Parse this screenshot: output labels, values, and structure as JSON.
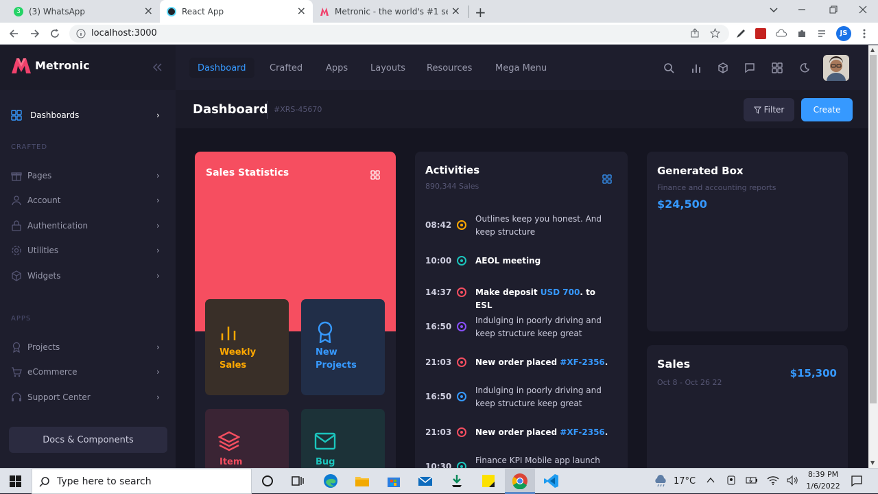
{
  "browser": {
    "tabs": [
      {
        "label": "(3) WhatsApp",
        "badge": "3"
      },
      {
        "label": "React App"
      },
      {
        "label": "Metronic - the world's #1 selling"
      }
    ],
    "url": "localhost:3000",
    "profile_initials": "JS"
  },
  "app": {
    "brand": "Metronic",
    "sidebar": {
      "top_item": "Dashboards",
      "section_crafted": "CRAFTED",
      "crafted_items": [
        "Pages",
        "Account",
        "Authentication",
        "Utilities",
        "Widgets"
      ],
      "section_apps": "APPS",
      "apps_items": [
        "Projects",
        "eCommerce",
        "Support Center"
      ],
      "docs_button": "Docs & Components"
    },
    "header_nav": [
      "Dashboard",
      "Crafted",
      "Apps",
      "Layouts",
      "Resources",
      "Mega Menu"
    ],
    "toolbar": {
      "title": "Dashboard",
      "code": "#XRS-45670",
      "filter_label": "Filter",
      "create_label": "Create"
    },
    "sales_statistics": {
      "title": "Sales Statistics",
      "tiles": [
        {
          "line1": "Weekly",
          "line2": "Sales"
        },
        {
          "line1": "New",
          "line2": "Projects"
        },
        {
          "line1": "Item",
          "line2": ""
        },
        {
          "line1": "Bug",
          "line2": ""
        }
      ]
    },
    "activities": {
      "title": "Activities",
      "subtitle": "890,344 Sales",
      "items": [
        {
          "time": "08:42",
          "text": "Outlines keep you honest. And keep structure",
          "bold": false,
          "color": "#ffa800"
        },
        {
          "time": "10:00",
          "text": "AEOL meeting",
          "bold": true,
          "color": "#1bc5bd"
        },
        {
          "time": "14:37",
          "text_pre": "Make deposit ",
          "link": "USD 700",
          "text_post": ". to ESL",
          "bold": true,
          "color": "#f64e60"
        },
        {
          "time": "16:50",
          "text": "Indulging in poorly driving and keep structure keep great",
          "bold": false,
          "color": "#8950fc"
        },
        {
          "time": "21:03",
          "text_pre": "New order placed ",
          "link": "#XF-2356",
          "text_post": ".",
          "bold": true,
          "color": "#f64e60"
        },
        {
          "time": "16:50",
          "text": "Indulging in poorly driving and keep structure keep great",
          "bold": false,
          "color": "#3699ff"
        },
        {
          "time": "21:03",
          "text_pre": "New order placed ",
          "link": "#XF-2356",
          "text_post": ".",
          "bold": true,
          "color": "#f64e60"
        },
        {
          "time": "10:30",
          "text": "Finance KPI Mobile app launch",
          "bold": false,
          "color": "#1bc5bd"
        }
      ]
    },
    "generated_box": {
      "title": "Generated Box",
      "subtitle": "Finance and accounting reports",
      "value": "$24,500"
    },
    "sales": {
      "title": "Sales",
      "date_range": "Oct 8 - Oct 26 22",
      "value": "$15,300"
    }
  },
  "taskbar": {
    "search_placeholder": "Type here to search",
    "weather": "17°C",
    "time": "8:39 PM",
    "date": "1/6/2022"
  },
  "colors": {
    "accent": "#3699ff",
    "danger": "#f64e60",
    "warning": "#ffa800",
    "success": "#1bc5bd"
  }
}
